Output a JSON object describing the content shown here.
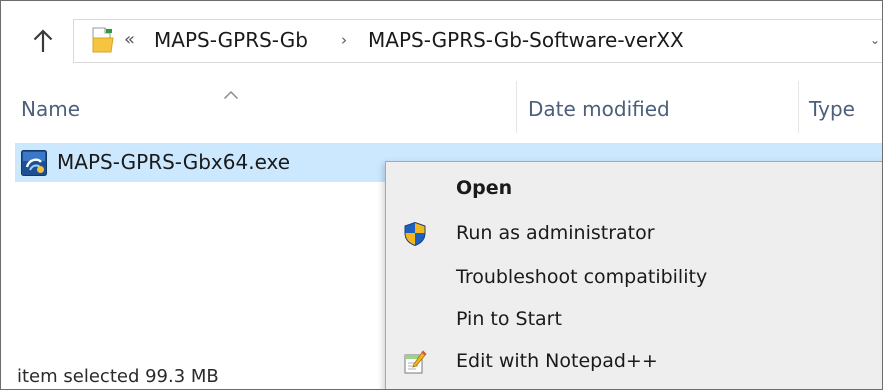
{
  "addressbar": {
    "overflow_label": "«",
    "crumbs": [
      "MAPS-GPRS-Gb",
      "MAPS-GPRS-Gb-Software-verXX"
    ],
    "separator": "›",
    "dropdown_glyph": "⌄",
    "icons": {
      "up": "up-arrow-icon",
      "folder": "folder-icon"
    }
  },
  "columns": {
    "name": "Name",
    "date_modified": "Date modified",
    "type": "Type",
    "sort_indicator": "ascending"
  },
  "files": [
    {
      "name": "MAPS-GPRS-Gbx64.exe",
      "selected": true,
      "icon": "exe-app-icon"
    }
  ],
  "status": {
    "text": "item selected  99.3 MB"
  },
  "context_menu": {
    "items": [
      {
        "label": "Open",
        "bold": true,
        "icon": ""
      },
      {
        "label": "Run as administrator",
        "bold": false,
        "icon": "uac-shield-icon"
      },
      {
        "label": "Troubleshoot compatibility",
        "bold": false,
        "icon": ""
      },
      {
        "label": "Pin to Start",
        "bold": false,
        "icon": ""
      },
      {
        "label": "Edit with Notepad++",
        "bold": false,
        "icon": "notepad-plus-plus-icon"
      }
    ]
  },
  "colors": {
    "selection": "#cce8ff",
    "header_text": "#4c607a",
    "menu_bg": "#eeeeee",
    "shield_blue": "#1f5fbf",
    "shield_gold": "#f2b81b",
    "folder_yellow": "#f5c542"
  }
}
